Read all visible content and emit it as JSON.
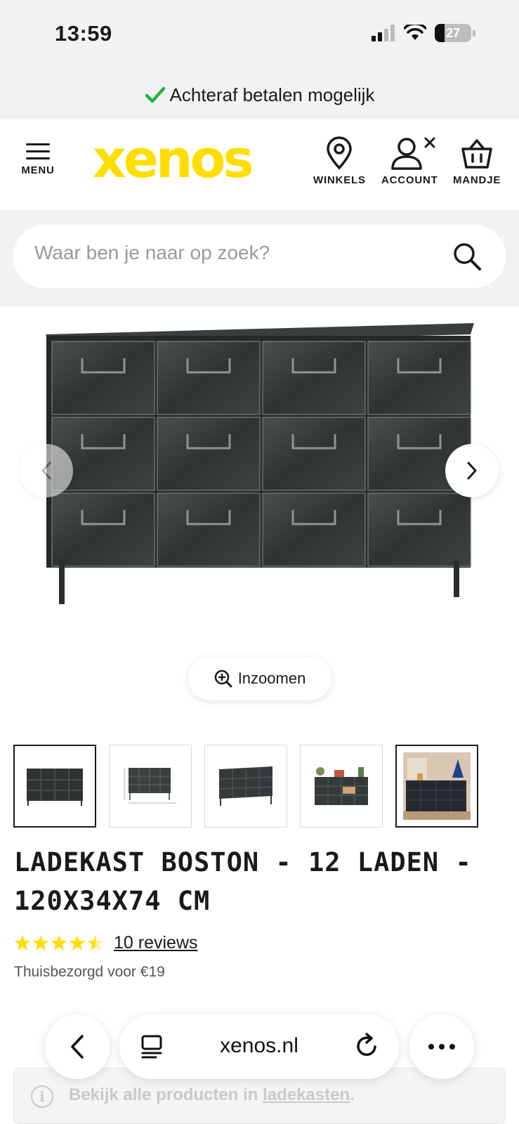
{
  "status": {
    "time": "13:59",
    "battery": "27"
  },
  "promo": {
    "text": "Achteraf betalen mogelijk",
    "icon": "check-icon"
  },
  "header": {
    "logo": "xenos",
    "menu_label": "MENU",
    "nav": [
      {
        "label": "WINKELS",
        "icon": "location-pin-icon"
      },
      {
        "label": "ACCOUNT",
        "icon": "user-icon"
      },
      {
        "label": "MANDJE",
        "icon": "basket-icon"
      }
    ]
  },
  "search": {
    "placeholder": "Waar ben je naar op zoek?"
  },
  "gallery": {
    "zoom_label": "Inzoomen",
    "thumbnail_count": 5,
    "active_thumbnail": [
      0,
      4
    ]
  },
  "product": {
    "title": "LADEKAST BOSTON - 12 LADEN - 120X34X74 CM",
    "rating": 4.5,
    "reviews_label": "10 reviews",
    "delivery": "Thuisbezorgd voor €19"
  },
  "info": {
    "prefix": "Bekijk alle producten in ",
    "link": "ladekasten",
    "suffix": "."
  },
  "browser": {
    "url": "xenos.nl"
  },
  "colors": {
    "brand": "#fede00",
    "check": "#22b14c",
    "text": "#1a1a1a"
  }
}
